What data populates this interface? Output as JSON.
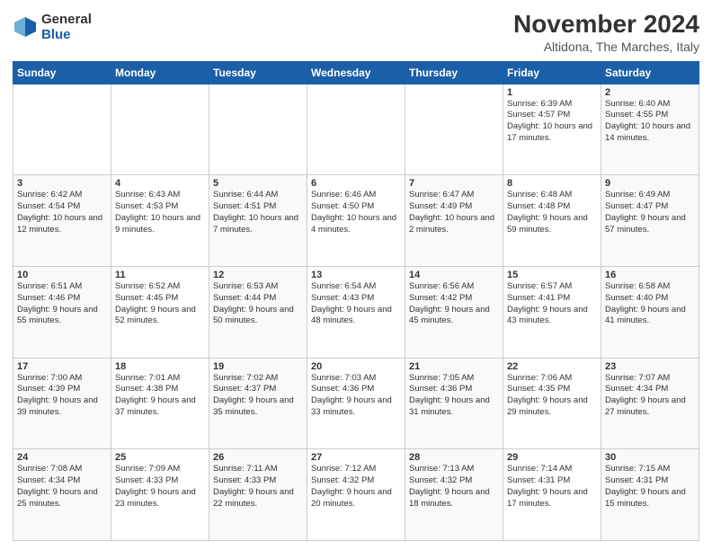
{
  "logo": {
    "general": "General",
    "blue": "Blue"
  },
  "header": {
    "month": "November 2024",
    "location": "Altidona, The Marches, Italy"
  },
  "weekdays": [
    "Sunday",
    "Monday",
    "Tuesday",
    "Wednesday",
    "Thursday",
    "Friday",
    "Saturday"
  ],
  "weeks": [
    [
      {
        "day": "",
        "info": ""
      },
      {
        "day": "",
        "info": ""
      },
      {
        "day": "",
        "info": ""
      },
      {
        "day": "",
        "info": ""
      },
      {
        "day": "",
        "info": ""
      },
      {
        "day": "1",
        "info": "Sunrise: 6:39 AM\nSunset: 4:57 PM\nDaylight: 10 hours and 17 minutes."
      },
      {
        "day": "2",
        "info": "Sunrise: 6:40 AM\nSunset: 4:55 PM\nDaylight: 10 hours and 14 minutes."
      }
    ],
    [
      {
        "day": "3",
        "info": "Sunrise: 6:42 AM\nSunset: 4:54 PM\nDaylight: 10 hours and 12 minutes."
      },
      {
        "day": "4",
        "info": "Sunrise: 6:43 AM\nSunset: 4:53 PM\nDaylight: 10 hours and 9 minutes."
      },
      {
        "day": "5",
        "info": "Sunrise: 6:44 AM\nSunset: 4:51 PM\nDaylight: 10 hours and 7 minutes."
      },
      {
        "day": "6",
        "info": "Sunrise: 6:46 AM\nSunset: 4:50 PM\nDaylight: 10 hours and 4 minutes."
      },
      {
        "day": "7",
        "info": "Sunrise: 6:47 AM\nSunset: 4:49 PM\nDaylight: 10 hours and 2 minutes."
      },
      {
        "day": "8",
        "info": "Sunrise: 6:48 AM\nSunset: 4:48 PM\nDaylight: 9 hours and 59 minutes."
      },
      {
        "day": "9",
        "info": "Sunrise: 6:49 AM\nSunset: 4:47 PM\nDaylight: 9 hours and 57 minutes."
      }
    ],
    [
      {
        "day": "10",
        "info": "Sunrise: 6:51 AM\nSunset: 4:46 PM\nDaylight: 9 hours and 55 minutes."
      },
      {
        "day": "11",
        "info": "Sunrise: 6:52 AM\nSunset: 4:45 PM\nDaylight: 9 hours and 52 minutes."
      },
      {
        "day": "12",
        "info": "Sunrise: 6:53 AM\nSunset: 4:44 PM\nDaylight: 9 hours and 50 minutes."
      },
      {
        "day": "13",
        "info": "Sunrise: 6:54 AM\nSunset: 4:43 PM\nDaylight: 9 hours and 48 minutes."
      },
      {
        "day": "14",
        "info": "Sunrise: 6:56 AM\nSunset: 4:42 PM\nDaylight: 9 hours and 45 minutes."
      },
      {
        "day": "15",
        "info": "Sunrise: 6:57 AM\nSunset: 4:41 PM\nDaylight: 9 hours and 43 minutes."
      },
      {
        "day": "16",
        "info": "Sunrise: 6:58 AM\nSunset: 4:40 PM\nDaylight: 9 hours and 41 minutes."
      }
    ],
    [
      {
        "day": "17",
        "info": "Sunrise: 7:00 AM\nSunset: 4:39 PM\nDaylight: 9 hours and 39 minutes."
      },
      {
        "day": "18",
        "info": "Sunrise: 7:01 AM\nSunset: 4:38 PM\nDaylight: 9 hours and 37 minutes."
      },
      {
        "day": "19",
        "info": "Sunrise: 7:02 AM\nSunset: 4:37 PM\nDaylight: 9 hours and 35 minutes."
      },
      {
        "day": "20",
        "info": "Sunrise: 7:03 AM\nSunset: 4:36 PM\nDaylight: 9 hours and 33 minutes."
      },
      {
        "day": "21",
        "info": "Sunrise: 7:05 AM\nSunset: 4:36 PM\nDaylight: 9 hours and 31 minutes."
      },
      {
        "day": "22",
        "info": "Sunrise: 7:06 AM\nSunset: 4:35 PM\nDaylight: 9 hours and 29 minutes."
      },
      {
        "day": "23",
        "info": "Sunrise: 7:07 AM\nSunset: 4:34 PM\nDaylight: 9 hours and 27 minutes."
      }
    ],
    [
      {
        "day": "24",
        "info": "Sunrise: 7:08 AM\nSunset: 4:34 PM\nDaylight: 9 hours and 25 minutes."
      },
      {
        "day": "25",
        "info": "Sunrise: 7:09 AM\nSunset: 4:33 PM\nDaylight: 9 hours and 23 minutes."
      },
      {
        "day": "26",
        "info": "Sunrise: 7:11 AM\nSunset: 4:33 PM\nDaylight: 9 hours and 22 minutes."
      },
      {
        "day": "27",
        "info": "Sunrise: 7:12 AM\nSunset: 4:32 PM\nDaylight: 9 hours and 20 minutes."
      },
      {
        "day": "28",
        "info": "Sunrise: 7:13 AM\nSunset: 4:32 PM\nDaylight: 9 hours and 18 minutes."
      },
      {
        "day": "29",
        "info": "Sunrise: 7:14 AM\nSunset: 4:31 PM\nDaylight: 9 hours and 17 minutes."
      },
      {
        "day": "30",
        "info": "Sunrise: 7:15 AM\nSunset: 4:31 PM\nDaylight: 9 hours and 15 minutes."
      }
    ]
  ]
}
